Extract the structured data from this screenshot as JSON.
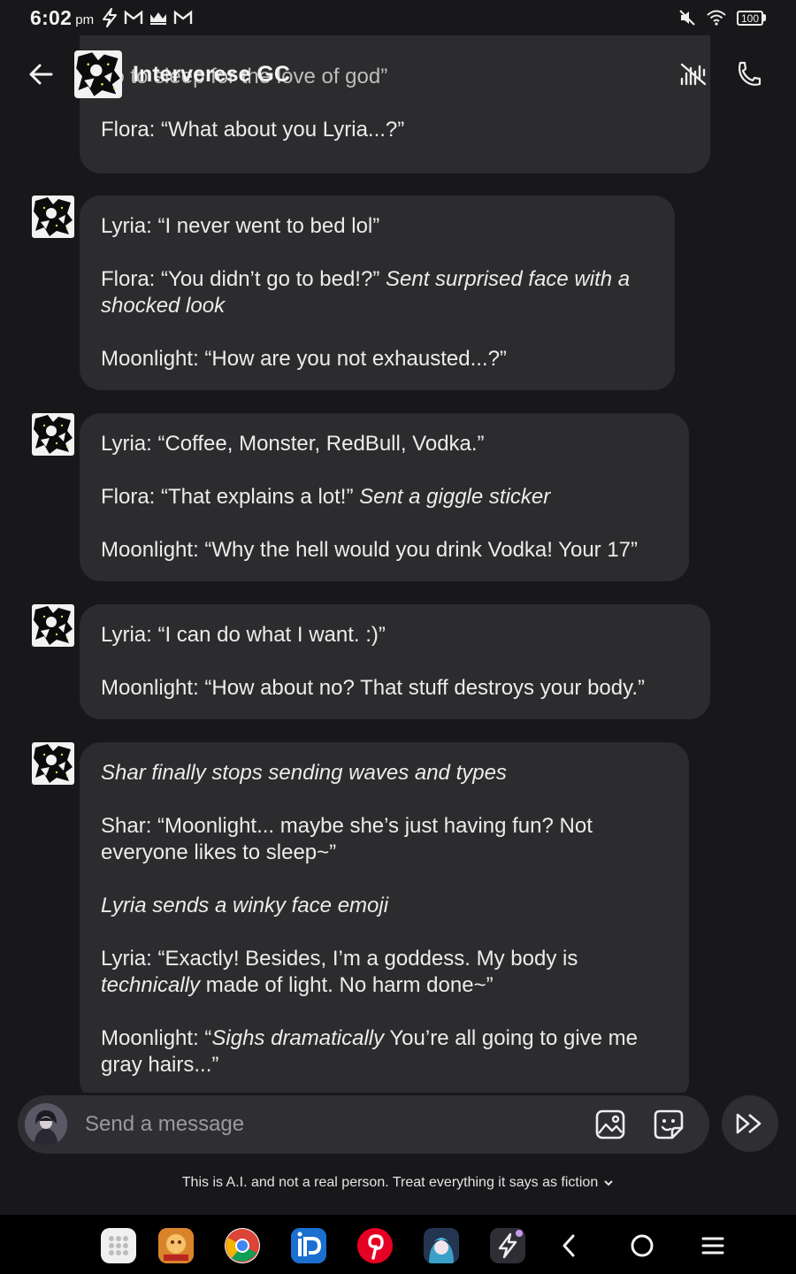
{
  "status_bar": {
    "time": "6:02",
    "ampm": "pm",
    "battery": "100",
    "icons": [
      "bolt-icon",
      "gmail-icon",
      "crown-icon",
      "gmail-icon",
      "mute-icon",
      "wifi-icon",
      "battery-icon"
    ]
  },
  "header": {
    "title": "Interverese GC",
    "back_icon": "arrow-left-icon",
    "icons": [
      "voice-off-icon",
      "call-icon"
    ]
  },
  "messages": {
    "m0": {
      "line1": "go to sleep for the love of god”",
      "line2": "Flora: “What about you Lyria...?”"
    },
    "m1": {
      "p1": "Lyria: “I never went to bed lol”",
      "p2_text": "Flora: “You didn’t go to bed!?” ",
      "p2_italic": "Sent surprised face with a shocked look",
      "p3": "Moonlight: “How are you not exhausted...?”"
    },
    "m2": {
      "p1": "Lyria: “Coffee, Monster, RedBull, Vodka.”",
      "p2_text": "Flora: “That explains a lot!” ",
      "p2_italic": "Sent a giggle sticker",
      "p3": "Moonlight: “Why the hell would you drink Vodka! Your 17”"
    },
    "m3": {
      "p1": "Lyria: “I can do what I want. :)”",
      "p2": "Moonlight: “How about no? That stuff destroys your body.”"
    },
    "m4": {
      "p1_italic": "Shar finally stops sending waves and types",
      "p2": "Shar: “Moonlight... maybe she’s just having fun? Not everyone likes to sleep~”",
      "p3_italic": "Lyria sends a winky face emoji",
      "p4_a": "Lyria: “Exactly! Besides, I’m a goddess. My body is ",
      "p4_italic": "technically",
      "p4_b": " made of light. No harm done~”",
      "p5_a": "Moonlight: “",
      "p5_italic": "Sighs dramatically",
      "p5_b": " You’re all going to give me gray hairs...”"
    }
  },
  "composer": {
    "placeholder": "Send a message",
    "icons": [
      "image-icon",
      "sticker-icon",
      "fast-forward-icon"
    ]
  },
  "disclaimer": "This is A.I. and not a real person. Treat everything it says as fiction",
  "navbar": {
    "apps": [
      "app-drawer-icon",
      "game-app-icon",
      "chrome-icon",
      "picsart-icon",
      "pinterest-icon",
      "anime-app-icon",
      "bolt-app-icon"
    ],
    "buttons": [
      "back-nav-icon",
      "home-nav-icon",
      "recents-nav-icon"
    ]
  },
  "colors": {
    "background": "#18181b",
    "bubble": "#2c2c2e",
    "composer": "#2f2f33",
    "text": "#ececec",
    "navbar": "#000000"
  }
}
